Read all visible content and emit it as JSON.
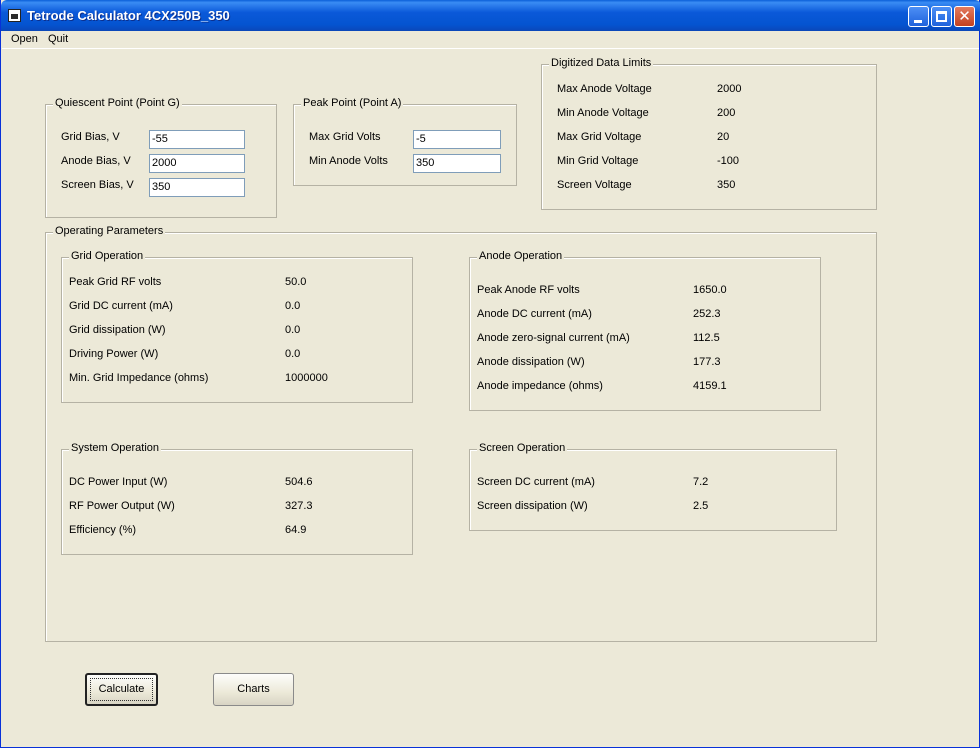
{
  "window": {
    "title": "Tetrode Calculator 4CX250B_350",
    "min_glyph": "",
    "max_glyph": "",
    "close_glyph": "✕"
  },
  "menu": {
    "open": "Open",
    "quit": "Quit"
  },
  "quiescent": {
    "legend": "Quiescent Point (Point G)",
    "grid_bias_label": "Grid Bias, V",
    "grid_bias_value": "-55",
    "anode_bias_label": "Anode Bias, V",
    "anode_bias_value": "2000",
    "screen_bias_label": "Screen Bias, V",
    "screen_bias_value": "350"
  },
  "peak": {
    "legend": "Peak Point (Point A)",
    "max_grid_label": "Max Grid Volts",
    "max_grid_value": "-5",
    "min_anode_label": "Min Anode Volts",
    "min_anode_value": "350"
  },
  "limits": {
    "legend": "Digitized Data Limits",
    "rows": [
      {
        "label": "Max Anode Voltage",
        "value": "2000"
      },
      {
        "label": "Min Anode Voltage",
        "value": "200"
      },
      {
        "label": "Max Grid Voltage",
        "value": "20"
      },
      {
        "label": "Min Grid Voltage",
        "value": "-100"
      },
      {
        "label": "Screen Voltage",
        "value": "350"
      }
    ]
  },
  "operating": {
    "legend": "Operating Parameters",
    "grid": {
      "legend": "Grid Operation",
      "rows": [
        {
          "label": "Peak Grid RF volts",
          "value": "50.0"
        },
        {
          "label": "Grid DC current (mA)",
          "value": "0.0"
        },
        {
          "label": "Grid dissipation (W)",
          "value": "0.0"
        },
        {
          "label": "Driving Power (W)",
          "value": "0.0"
        },
        {
          "label": "Min. Grid Impedance (ohms)",
          "value": "1000000"
        }
      ]
    },
    "anode": {
      "legend": "Anode Operation",
      "rows": [
        {
          "label": "Peak Anode RF volts",
          "value": "1650.0"
        },
        {
          "label": "Anode DC current (mA)",
          "value": "252.3"
        },
        {
          "label": "Anode zero-signal current (mA)",
          "value": "112.5"
        },
        {
          "label": "Anode dissipation (W)",
          "value": "177.3"
        },
        {
          "label": "Anode impedance (ohms)",
          "value": "4159.1"
        }
      ]
    },
    "system": {
      "legend": "System Operation",
      "rows": [
        {
          "label": "DC Power Input (W)",
          "value": "504.6"
        },
        {
          "label": "RF Power Output (W)",
          "value": "327.3"
        },
        {
          "label": "Efficiency (%)",
          "value": "64.9"
        }
      ]
    },
    "screen": {
      "legend": "Screen Operation",
      "rows": [
        {
          "label": "Screen DC current (mA)",
          "value": "7.2"
        },
        {
          "label": "Screen dissipation (W)",
          "value": "2.5"
        }
      ]
    }
  },
  "buttons": {
    "calculate": "Calculate",
    "charts": "Charts"
  }
}
